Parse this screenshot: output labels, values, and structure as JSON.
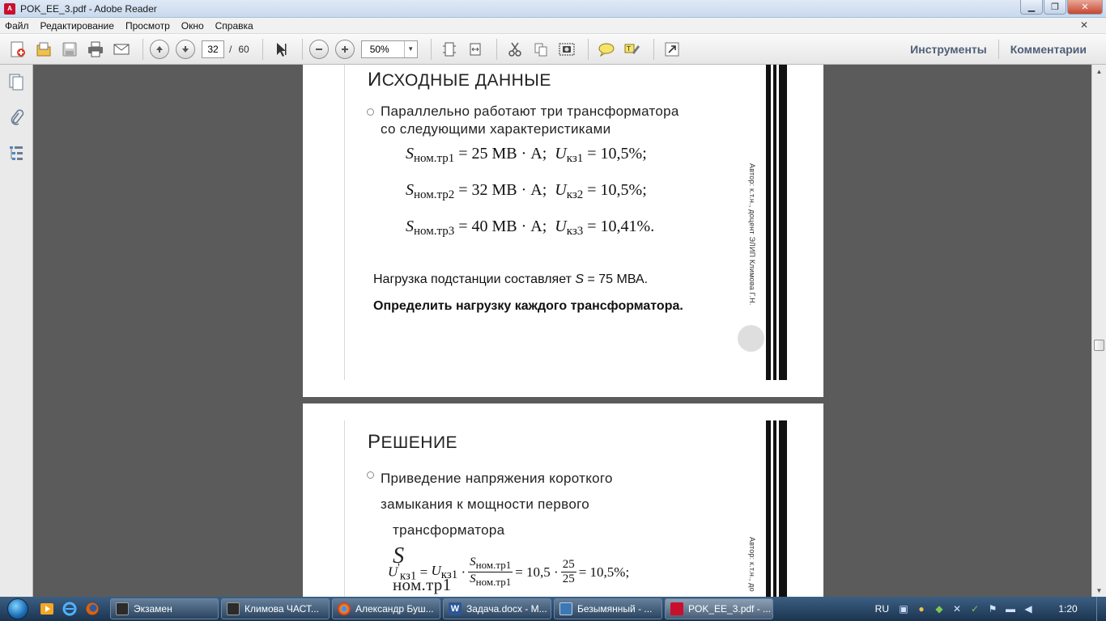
{
  "window": {
    "title": "POK_EE_3.pdf - Adobe Reader",
    "controls": {
      "minimize": "▁",
      "maximize": "❐",
      "close": "✕"
    }
  },
  "menu": {
    "items": [
      "Файл",
      "Редактирование",
      "Просмотр",
      "Окно",
      "Справка"
    ],
    "close_glyph": "✕"
  },
  "toolbar": {
    "page_current": "32",
    "page_separator": "/",
    "page_total": "60",
    "zoom": "50%",
    "tools_label": "Инструменты",
    "comments_label": "Комментарии"
  },
  "page1": {
    "title_cap": "И",
    "title_rest": "СХОДНЫЕ ДАННЫЕ",
    "bullet_line1": "Параллельно работают три трансформатора",
    "bullet_line2": "со следующими характеристиками",
    "formulas": [
      {
        "s_sub": "ном.тр1",
        "s_val": "= 25  МВ · А;",
        "u_sub": "кз1",
        "u_val": "= 10,5%;"
      },
      {
        "s_sub": "ном.тр2",
        "s_val": "= 32  МВ · А;",
        "u_sub": "кз2",
        "u_val": "= 10,5%;"
      },
      {
        "s_sub": "ном.тр3",
        "s_val": "= 40  МВ · А;",
        "u_sub": "кз3",
        "u_val": "= 10,41%."
      }
    ],
    "load_prefix": "Нагрузка подстанции составляет ",
    "load_symbol": "S",
    "load_suffix": " = 75 МВА.",
    "task": "Определить нагрузку каждого трансформатора.",
    "author": "Автор: к.т.н., доцент ЭЛИП Климова Г.Н."
  },
  "page2": {
    "title_cap": "Р",
    "title_rest": "ЕШЕНИЕ",
    "bullet_line1": "Приведение напряжения короткого",
    "bullet_line2": "замыкания к мощности первого",
    "bullet_line3": "трансформатора",
    "s_symbol": "S",
    "s_sub": "ном.тр1",
    "eq": {
      "u_prime_sub": "кз1",
      "u_sub": "кз1",
      "frac1_num": "ном.тр1",
      "frac1_den": "ном.тр1",
      "coef": "= 10,5 ·",
      "frac2_num": "25",
      "frac2_den": "25",
      "result": "= 10,5%;"
    },
    "author": "Автор: к.т.н., до"
  },
  "taskbar": {
    "tasks": [
      "Экзамен",
      "Климова ЧАСТ...",
      "Александр Буш...",
      "Задача.docx - M...",
      "Безымянный - ...",
      "POK_EE_3.pdf - ..."
    ],
    "task_colors": [
      "#2b2b2b",
      "#2b2b2b",
      "#e8a21c",
      "#2b5797",
      "#3c78b4",
      "#c8102e"
    ],
    "lang": "RU",
    "time": "1:20"
  }
}
